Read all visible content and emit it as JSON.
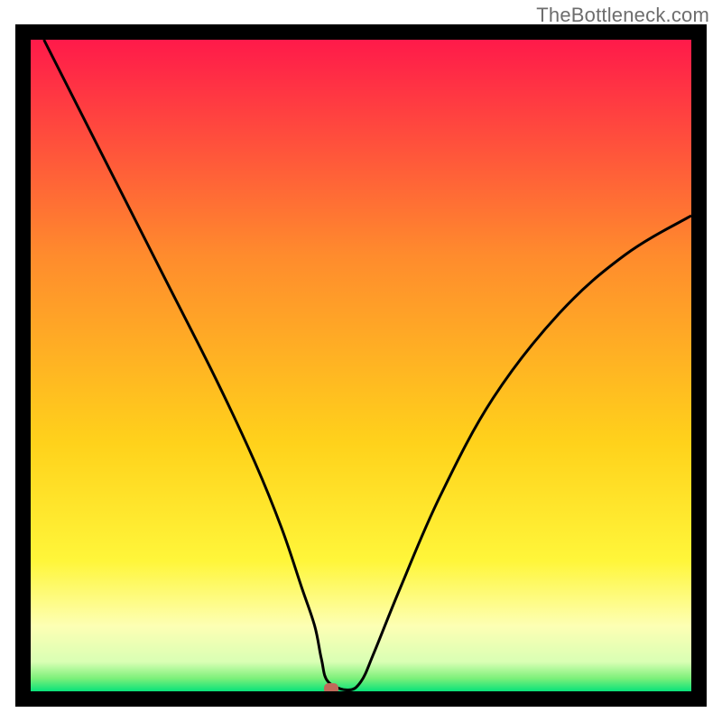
{
  "watermark": "TheBottleneck.com",
  "chart_data": {
    "type": "line",
    "title": "",
    "xlabel": "",
    "ylabel": "",
    "xlim": [
      0,
      100
    ],
    "ylim": [
      0,
      100
    ],
    "grid": false,
    "legend": false,
    "series": [
      {
        "name": "curve",
        "x": [
          2,
          10,
          20,
          28,
          34,
          38,
          41,
          43,
          44,
          45,
          48,
          50,
          52,
          56,
          62,
          70,
          80,
          90,
          100
        ],
        "y": [
          100,
          84,
          64,
          48,
          35,
          25,
          16,
          10,
          5,
          1.5,
          0.2,
          1.5,
          6,
          16,
          30,
          45,
          58,
          67,
          73
        ],
        "color": "#000000"
      }
    ],
    "marker": {
      "x": 45.5,
      "y": 0.4,
      "color": "#c1695a"
    },
    "gradient_stops": [
      {
        "offset": 0,
        "color": "#ff1a4a"
      },
      {
        "offset": 0.33,
        "color": "#ff8b2d"
      },
      {
        "offset": 0.62,
        "color": "#ffd21b"
      },
      {
        "offset": 0.8,
        "color": "#fff63a"
      },
      {
        "offset": 0.9,
        "color": "#fdffb4"
      },
      {
        "offset": 0.955,
        "color": "#d9ffb4"
      },
      {
        "offset": 0.98,
        "color": "#7df07a"
      },
      {
        "offset": 1.0,
        "color": "#09e27a"
      }
    ]
  }
}
